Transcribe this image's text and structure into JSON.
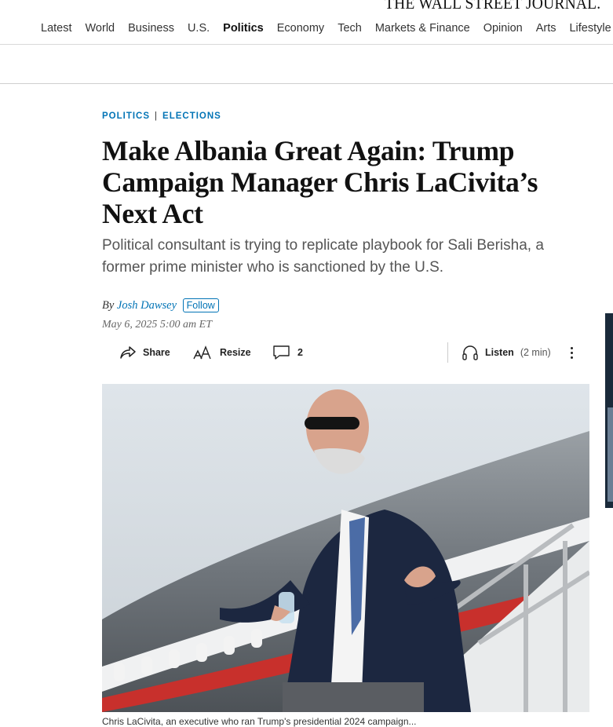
{
  "masthead": {
    "logo": "THE WALL STREET JOURNAL.",
    "nav": [
      "Latest",
      "World",
      "Business",
      "U.S.",
      "Politics",
      "Economy",
      "Tech",
      "Markets & Finance",
      "Opinion",
      "Arts",
      "Lifestyle"
    ],
    "active_nav": "Politics"
  },
  "article": {
    "kicker_primary": "POLITICS",
    "kicker_secondary": "ELECTIONS",
    "headline": "Make Albania Great Again: Trump Campaign Manager Chris LaCivita’s Next Act",
    "dek": "Political consultant is trying to replicate playbook for Sali Berisha, a former prime minister who is sanctioned by the U.S.",
    "byline_prefix": "By",
    "author": "Josh Dawsey",
    "follow_label": "Follow",
    "timestamp": "May 6, 2025 5:00 am ET",
    "caption": "Chris LaCivita, an executive who ran Trump's presidential 2024 campaign..."
  },
  "toolbar": {
    "share_label": "Share",
    "resize_label": "Resize",
    "comments_count": "2",
    "listen_label": "Listen",
    "listen_duration": "(2 min)"
  },
  "icons": [
    "share-icon",
    "resize-icon",
    "comment-icon",
    "headphones-icon",
    "more-icon"
  ],
  "colors": {
    "accent": "#0274b6",
    "text": "#111111",
    "dek": "#555555"
  }
}
